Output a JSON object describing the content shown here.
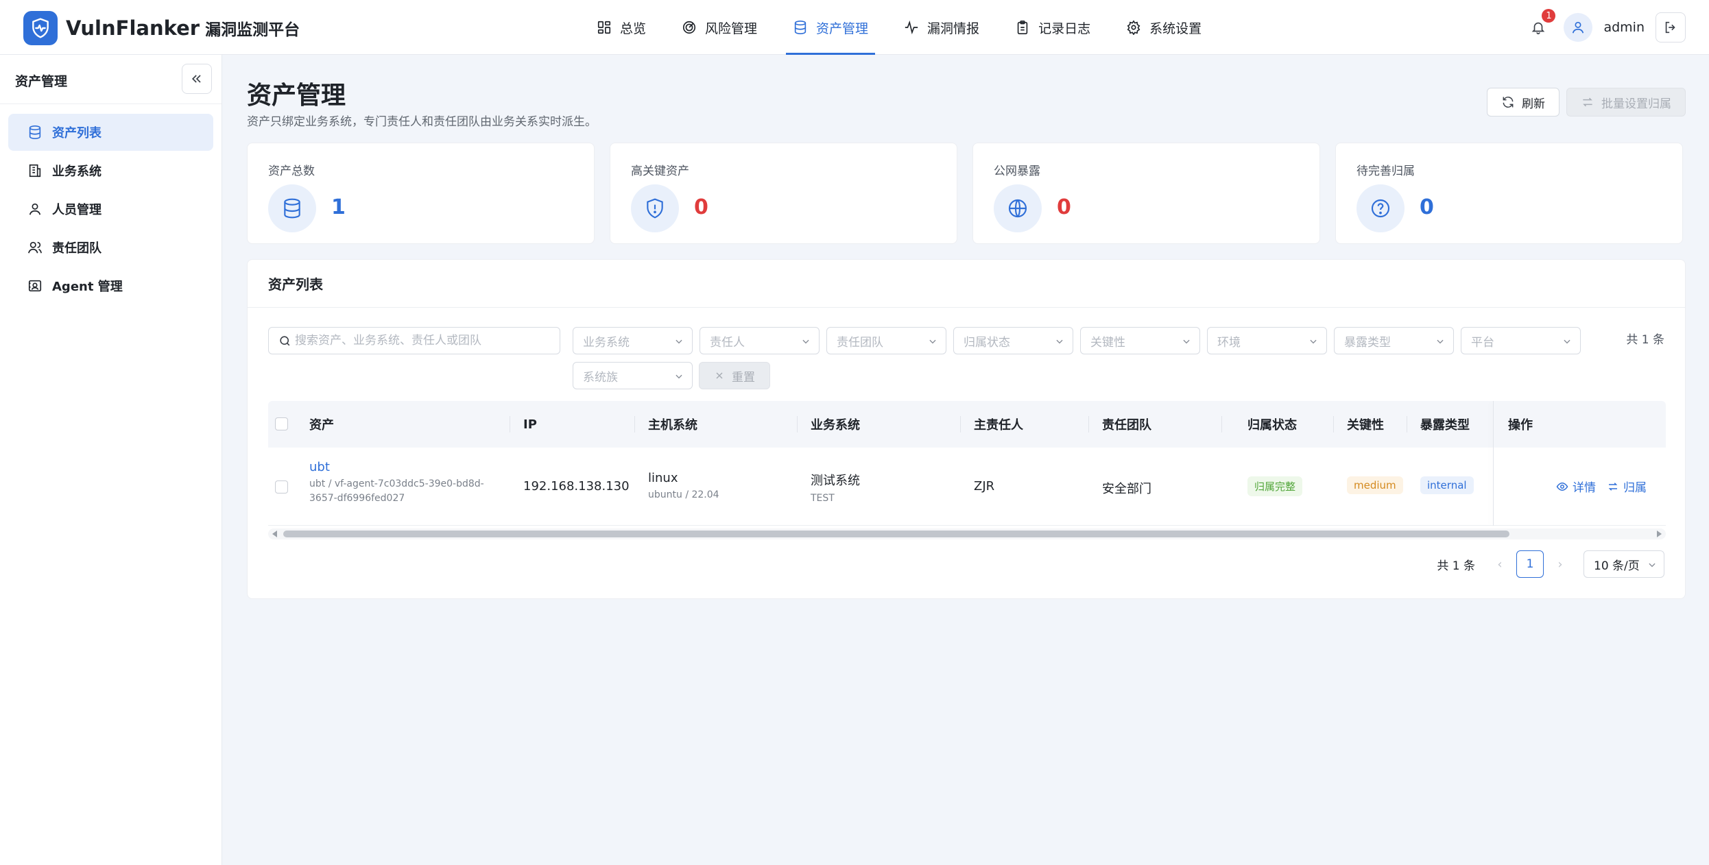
{
  "brand": {
    "name": "VulnFlanker",
    "subtitle": "漏洞监测平台"
  },
  "nav": [
    {
      "label": "总览",
      "icon": "dashboard-icon",
      "active": false
    },
    {
      "label": "风险管理",
      "icon": "radar-icon",
      "active": false
    },
    {
      "label": "资产管理",
      "icon": "database-icon",
      "active": true
    },
    {
      "label": "漏洞情报",
      "icon": "activity-icon",
      "active": false
    },
    {
      "label": "记录日志",
      "icon": "clipboard-icon",
      "active": false
    },
    {
      "label": "系统设置",
      "icon": "gear-icon",
      "active": false
    }
  ],
  "user": {
    "name": "admin",
    "notifications": "1"
  },
  "sidebar": {
    "title": "资产管理",
    "items": [
      {
        "label": "资产列表",
        "icon": "database-icon",
        "active": true
      },
      {
        "label": "业务系统",
        "icon": "building-icon",
        "active": false
      },
      {
        "label": "人员管理",
        "icon": "user-icon",
        "active": false
      },
      {
        "label": "责任团队",
        "icon": "users-icon",
        "active": false
      },
      {
        "label": "Agent 管理",
        "icon": "agent-icon",
        "active": false
      }
    ]
  },
  "page": {
    "title": "资产管理",
    "description": "资产只绑定业务系统，专门责任人和责任团队由业务关系实时派生。",
    "refresh_label": "刷新",
    "batch_label": "批量设置归属"
  },
  "stats": [
    {
      "label": "资产总数",
      "value": "1",
      "icon": "database-icon",
      "color": "#2f6fd8"
    },
    {
      "label": "高关键资产",
      "value": "0",
      "icon": "shield-alert-icon",
      "color": "#e03c3c"
    },
    {
      "label": "公网暴露",
      "value": "0",
      "icon": "globe-icon",
      "color": "#e03c3c"
    },
    {
      "label": "待完善归属",
      "value": "0",
      "icon": "question-icon",
      "color": "#2f6fd8"
    }
  ],
  "list": {
    "title": "资产列表",
    "search_placeholder": "搜索资产、业务系统、责任人或团队",
    "filters": [
      "业务系统",
      "责任人",
      "责任团队",
      "归属状态",
      "关键性",
      "环境",
      "暴露类型",
      "平台",
      "系统族"
    ],
    "reset_label": "重置",
    "total_text": "共 1 条",
    "columns": [
      "资产",
      "IP",
      "主机系统",
      "业务系统",
      "主责任人",
      "责任团队",
      "归属状态",
      "关键性",
      "暴露类型",
      "操作"
    ],
    "rows": [
      {
        "asset_name": "ubt",
        "asset_sub": "ubt / vf-agent-7c03ddc5-39e0-bd8d-3657-df6996fed027",
        "ip": "192.168.138.130",
        "os": "linux",
        "os_sub": "ubuntu / 22.04",
        "business": "测试系统",
        "business_sub": "TEST",
        "owner": "ZJR",
        "team": "安全部门",
        "status": "归属完整",
        "criticality": "medium",
        "exposure": "internal",
        "op_detail": "详情",
        "op_assign": "归属"
      }
    ]
  },
  "pagination": {
    "total": "共 1 条",
    "page": "1",
    "page_size": "10 条/页"
  }
}
